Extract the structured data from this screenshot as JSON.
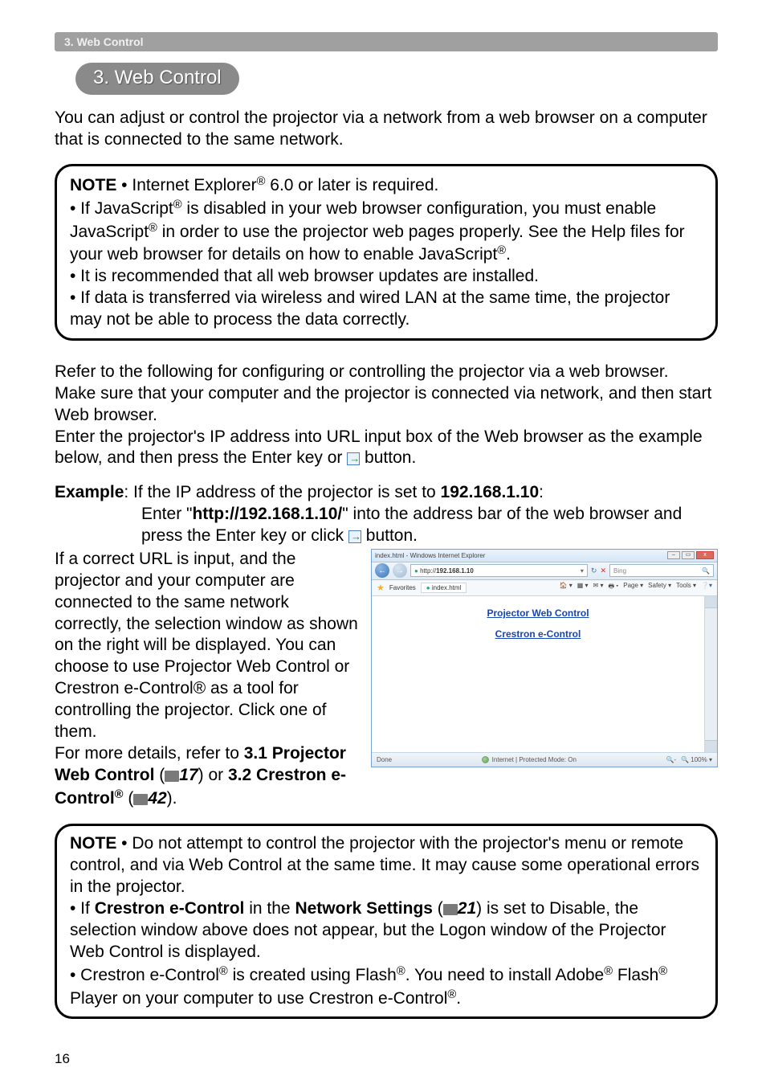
{
  "topbar": {
    "label": "3. Web Control"
  },
  "section_pill": "3. Web Control",
  "intro": "You can adjust or control the projector via a network from a web browser on a computer that is connected to the same network.",
  "note1": {
    "label": "NOTE",
    "l1a": " • Internet Explorer",
    "l1b": " 6.0 or later is required.",
    "l2a": "• If JavaScript",
    "l2b": " is disabled in your web browser configuration, you must enable JavaScript",
    "l2c": " in order to use the projector web pages properly. See the Help files for your web browser for details on how to enable JavaScript",
    "l2d": ".",
    "l3": "• It is recommended that all web browser updates are installed.",
    "l4": "• If data is transferred via wireless and wired LAN at the same time, the projector may not be able to process the data correctly."
  },
  "para2a": "Refer to the following for configuring or controlling the projector via a web browser.",
  "para2b": "Make sure that your computer and the projector is connected via network, and then start Web browser.",
  "para2c": "Enter the projector's IP address into URL input box of the Web browser as the example below, and then press the Enter key or ",
  "para2d": " button.",
  "example": {
    "label": "Example",
    "rest": ": If the IP address of the projector is set to ",
    "ip": "192.168.1.10",
    "colon": ":",
    "line2a": "Enter \"",
    "url": "http://192.168.1.10/",
    "line2b": "\" into the address bar of the web browser and press the Enter key or click ",
    "line2c": " button."
  },
  "leftcol": {
    "p1": "If a correct URL is input, and the projector and your computer are connected to the same network correctly, the selection window as shown on the right will be displayed. You can choose to use Projector Web Control or Crestron e-Control® as a tool for controlling the projector. Click one of them.",
    "p2a": "For more details, refer to ",
    "p2b": "3.1 Projector Web Control",
    "p2c": " (",
    "p2ref1": "17",
    "p2d": ") or ",
    "p2e": "3.2 Crestron e-Control",
    "p2f": " (",
    "p2ref2": "42",
    "p2g": ")."
  },
  "screenshot": {
    "title": "index.html - Windows Internet Explorer",
    "addr_prefix": "http://",
    "addr_host": "192.168.1.10",
    "search_hint": "Bing",
    "fav": "Favorites",
    "tab": "index.html",
    "menu_page": "Page ▾",
    "menu_safety": "Safety ▾",
    "menu_tools": "Tools ▾",
    "link1": "Projector Web Control",
    "link2": "Crestron e-Control",
    "status_done": "Done",
    "status_zone": "Internet | Protected Mode: On",
    "status_zoom": "100%"
  },
  "note2": {
    "label": "NOTE",
    "l1": " • Do not attempt to control the projector with the projector's menu or remote control, and via Web Control at the same time. It may cause some operational errors in the projector.",
    "l2a": "• If ",
    "l2b": "Crestron e-Control",
    "l2c": " in the ",
    "l2d": "Network Settings",
    "l2e": " (",
    "l2ref": "21",
    "l2f": ") is set to Disable, the selection window above does not appear, but the Logon window of the Projector Web Control is displayed.",
    "l3a": "• Crestron e-Control",
    "l3b": " is created using Flash",
    "l3c": ". You need to install Adobe",
    "l3d": " Flash",
    "l3e": " Player on your computer to use Crestron e-Control",
    "l3f": "."
  },
  "page_number": "16",
  "symbols": {
    "reg": "®"
  }
}
